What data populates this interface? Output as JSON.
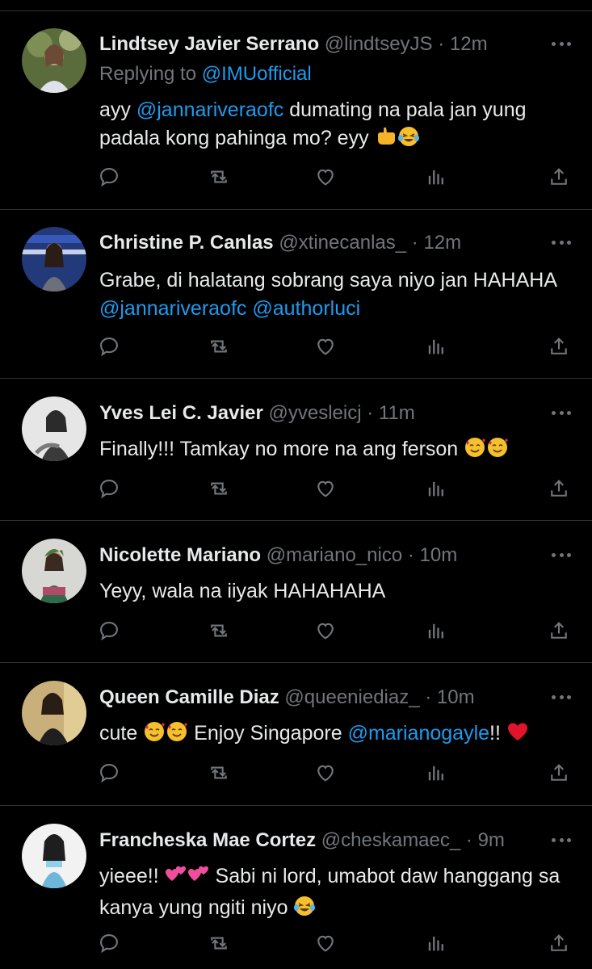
{
  "tweets": [
    {
      "name": "Lindtsey Javier Serrano",
      "handle": "@lindtseyJS",
      "dot": "·",
      "time": "12m",
      "reply_prefix": "Replying to ",
      "reply_handle": "@IMUofficial",
      "text_1": "ayy ",
      "mention_1": "@jannariveraofc",
      "text_2": " dumating na pala jan yung padala kong pahinga mo? eyy "
    },
    {
      "name": "Christine P. Canlas",
      "handle": "@xtinecanlas_",
      "dot": "·",
      "time": "12m",
      "text_1": "Grabe, di halatang sobrang saya niyo jan HAHAHA ",
      "mention_1": "@jannariveraofc",
      "mention_2": "@authorluci"
    },
    {
      "name": "Yves Lei C. Javier",
      "handle": "@yvesleicj",
      "dot": "·",
      "time": "11m",
      "text_1": "Finally!!! Tamkay no more na ang ferson "
    },
    {
      "name": "Nicolette Mariano",
      "handle": "@mariano_nico",
      "dot": "·",
      "time": "10m",
      "text_1": "Yeyy, wala na iiyak HAHAHAHA"
    },
    {
      "name": "Queen Camille Diaz",
      "handle": "@queeniediaz_",
      "dot": "·",
      "time": "10m",
      "text_1": "cute ",
      "text_2": " Enjoy Singapore ",
      "mention_1": "@marianogayle",
      "text_3": "!! "
    },
    {
      "name": "Francheska Mae Cortez",
      "handle": "@cheskamaec_",
      "dot": "·",
      "time": "9m",
      "text_1": "yieee!! ",
      "text_2": " Sabi ni lord, umabot daw hanggang sa kanya yung ngiti niyo "
    }
  ],
  "icons": {
    "reply": "reply-icon",
    "retweet": "retweet-icon",
    "like": "like-icon",
    "views": "views-icon",
    "share": "share-icon",
    "more": "more-icon"
  },
  "colors": {
    "background": "#000000",
    "text": "#e7e9ea",
    "muted": "#71767b",
    "link": "#1d9bf0",
    "divider": "#2f3336"
  }
}
